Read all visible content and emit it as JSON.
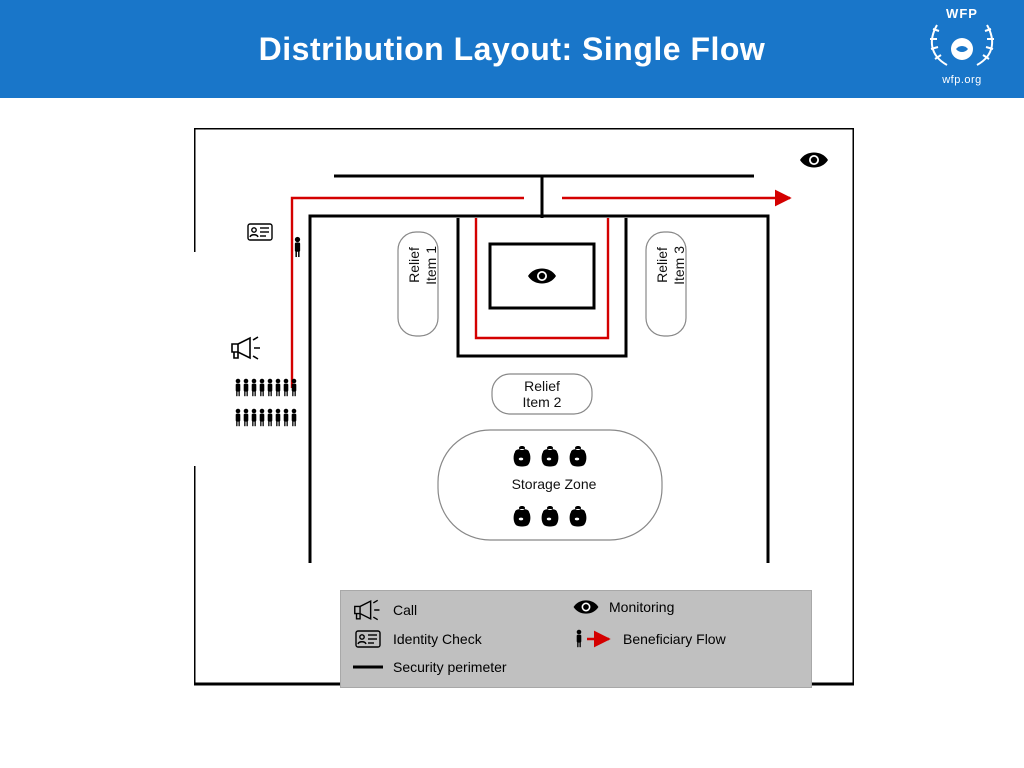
{
  "header": {
    "title": "Distribution Layout: Single Flow"
  },
  "logo": {
    "top": "WFP",
    "bottom": "wfp.org"
  },
  "labels": {
    "relief1": "Relief\nItem 1",
    "relief2": "Relief\nItem 2",
    "relief3": "Relief\nItem 3",
    "storage": "Storage Zone"
  },
  "legend": {
    "call": "Call",
    "monitoring": "Monitoring",
    "identity": "Identity Check",
    "flow": "Beneficiary Flow",
    "perimeter": "Security perimeter"
  }
}
